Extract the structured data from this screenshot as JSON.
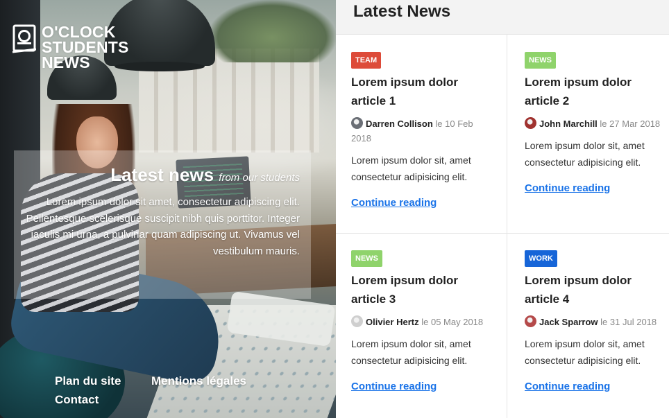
{
  "brand": {
    "line1": "O'CLOCK",
    "line2": "STUDENTS",
    "line3": "NEWS"
  },
  "hero": {
    "title": "Latest news",
    "subtitle": "from our students",
    "text": "Lorem ipsum dolor sit amet, consectetur adipiscing elit. Pellentesque scelerisque suscipit nibh quis porttitor. Integer iaculis mi urna, a pulvinar quam adipiscing ut. Vivamus vel vestibulum mauris.",
    "image_alt": "Student smiling, sitting near a laptop in a cafe"
  },
  "footer": {
    "links": [
      "Plan du site",
      "Mentions légales",
      "Contact"
    ]
  },
  "news": {
    "heading": "Latest News",
    "date_prefix": "le",
    "articles": [
      {
        "badge": "TEAM",
        "badge_color": "#dd4b39",
        "title": "Lorem ipsum dolor article 1",
        "author": "Darren Collison",
        "date": "10 Feb 2018",
        "avatar_color": "#6b6f76",
        "excerpt": "Lorem ipsum dolor sit, amet consectetur adipisicing elit.",
        "link": "Continue reading"
      },
      {
        "badge": "NEWS",
        "badge_color": "#8fd36b",
        "title": "Lorem ipsum dolor article 2",
        "author": "John Marchill",
        "date": "27 Mar 2018",
        "avatar_color": "#a0322f",
        "excerpt": "Lorem ipsum dolor sit, amet consectetur adipisicing elit.",
        "link": "Continue reading"
      },
      {
        "badge": "NEWS",
        "badge_color": "#8fd36b",
        "title": "Lorem ipsum dolor article 3",
        "author": "Olivier Hertz",
        "date": "05 May 2018",
        "avatar_color": "#cfcfcf",
        "excerpt": "Lorem ipsum dolor sit, amet consectetur adipisicing elit.",
        "link": "Continue reading"
      },
      {
        "badge": "WORK",
        "badge_color": "#1665d8",
        "title": "Lorem ipsum dolor article 4",
        "author": "Jack Sparrow",
        "date": "31 Jul 2018",
        "avatar_color": "#b54a4a",
        "excerpt": "Lorem ipsum dolor sit, amet consectetur adipisicing elit.",
        "link": "Continue reading"
      }
    ]
  }
}
